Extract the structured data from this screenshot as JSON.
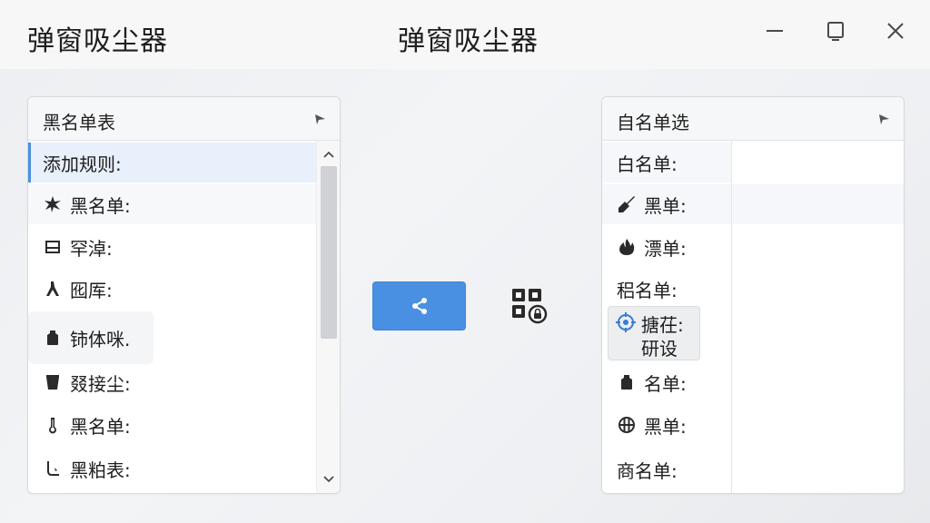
{
  "window": {
    "app_title": "弹窗吸尘器",
    "title": "弹窗吸尘器",
    "controls": [
      "minimize-icon",
      "maximize-icon",
      "close-icon"
    ]
  },
  "left_panel": {
    "title": "黑名单表",
    "items": [
      {
        "label": "添加规则:",
        "icon": "",
        "selected": true
      },
      {
        "label": "黑名单:",
        "icon": "splat-icon"
      },
      {
        "label": "罕淖:",
        "icon": "window-icon"
      },
      {
        "label": "囮厍:",
        "icon": "fork-icon"
      },
      {
        "label": "铈体咪.",
        "icon": "bag-icon"
      },
      {
        "label": "叕接尘:",
        "icon": "bin-icon"
      },
      {
        "label": "黑名单:",
        "icon": "thermometer-icon"
      },
      {
        "label": "黑粕表:",
        "icon": "hook-icon"
      }
    ]
  },
  "right_panel": {
    "title": "自名单选",
    "items": [
      {
        "label": "白名单:",
        "icon": ""
      },
      {
        "label": "黑单:",
        "icon": "broom-icon"
      },
      {
        "label": "漂单:",
        "icon": "flame-icon"
      },
      {
        "label": "稆名单:",
        "icon": ""
      },
      {
        "label": "搪茌:",
        "label2": "研设",
        "icon": "target-icon"
      },
      {
        "label": "名单:",
        "icon": "bag-icon"
      },
      {
        "label": "黑单:",
        "icon": "globe-icon"
      },
      {
        "label": "商名单:",
        "icon": ""
      }
    ]
  },
  "actions": {
    "share_icon": "share-icon",
    "qr_icon": "qr-lock-icon"
  },
  "colors": {
    "accent": "#4a90e2",
    "selection": "#e8f0fb"
  }
}
